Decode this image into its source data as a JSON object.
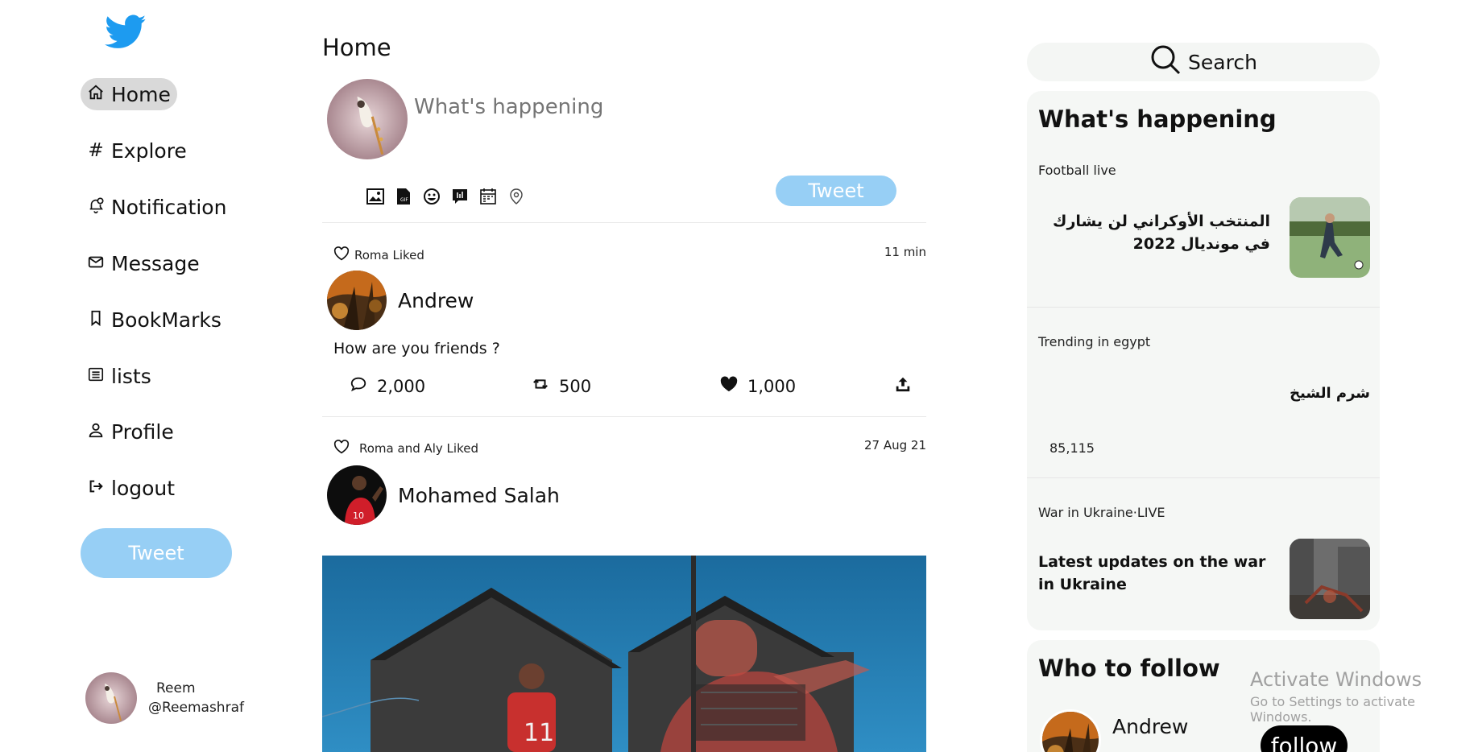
{
  "colors": {
    "accent": "#1d9bf0",
    "button_light": "#97cff5",
    "panel_bg": "#f5f7f5",
    "active_nav": "#d9d9d9"
  },
  "sidebar": {
    "items": [
      {
        "label": "Home",
        "icon": "home-icon"
      },
      {
        "label": "Explore",
        "icon": "hash-icon"
      },
      {
        "label": "Notification",
        "icon": "bell-icon"
      },
      {
        "label": "Message",
        "icon": "envelope-icon"
      },
      {
        "label": "BookMarks",
        "icon": "bookmark-icon"
      },
      {
        "label": "lists",
        "icon": "list-icon"
      },
      {
        "label": "Profile",
        "icon": "person-icon"
      },
      {
        "label": "logout",
        "icon": "logout-icon"
      }
    ],
    "tweet_button": "Tweet",
    "user": {
      "name": "Reem",
      "handle": "@Reemashraf"
    }
  },
  "main": {
    "title": "Home",
    "compose": {
      "placeholder": "What's happening",
      "tweet_button": "Tweet"
    },
    "posts": [
      {
        "liked_by": "Roma Liked",
        "time": "11 min",
        "author": "Andrew",
        "text": "How are you friends ?",
        "replies": "2,000",
        "retweets": "500",
        "likes": "1,000"
      },
      {
        "liked_by": "Roma and Aly Liked",
        "time": "27 Aug 21",
        "author": "Mohamed Salah"
      }
    ]
  },
  "right": {
    "search_label": "Search",
    "happening": {
      "title": "What's happening",
      "trends": [
        {
          "category": "Football live",
          "title": "المنتخب الأوكراني لن يشارك في مونديال 2022"
        },
        {
          "category": "Trending in egypt",
          "title": "شرم الشيخ",
          "count": "85,115"
        },
        {
          "category": "War in Ukraine·LIVE",
          "title": "Latest updates on the war in Ukraine"
        }
      ]
    },
    "who_to_follow": {
      "title": "Who to follow",
      "name": "Andrew",
      "button": "follow"
    }
  },
  "watermark": {
    "line1": "Activate Windows",
    "line2": "Go to Settings to activate Windows."
  }
}
